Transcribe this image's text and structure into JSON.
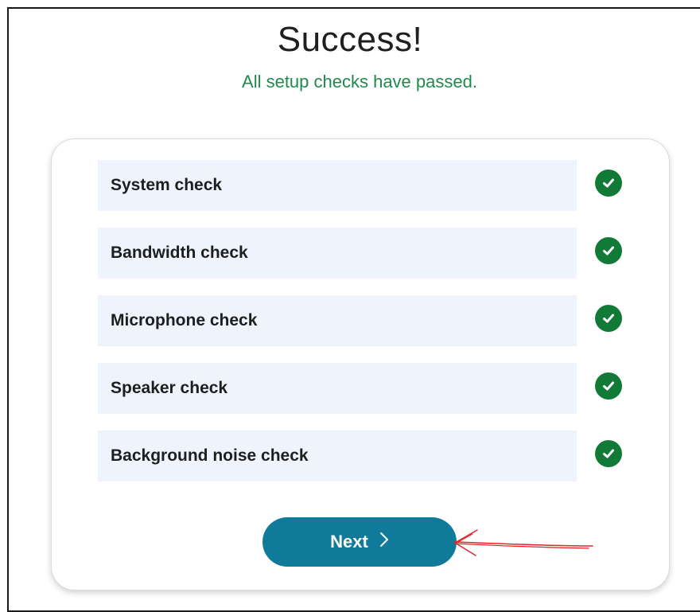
{
  "header": {
    "title": "Success!",
    "subtitle": "All setup checks have passed."
  },
  "checks": [
    {
      "label": "System check",
      "status": "passed",
      "icon": "checkmark-circle-icon"
    },
    {
      "label": "Bandwidth check",
      "status": "passed",
      "icon": "checkmark-circle-icon"
    },
    {
      "label": "Microphone check",
      "status": "passed",
      "icon": "checkmark-circle-icon"
    },
    {
      "label": "Speaker check",
      "status": "passed",
      "icon": "checkmark-circle-icon"
    },
    {
      "label": "Background noise check",
      "status": "passed",
      "icon": "checkmark-circle-icon"
    }
  ],
  "actions": {
    "next_label": "Next",
    "next_icon": "chevron-right-icon"
  },
  "annotation": {
    "icon": "red-arrow-icon",
    "color": "#e0262b"
  },
  "colors": {
    "success_text": "#1f8a4c",
    "check_icon": "#117a37",
    "row_background": "#eef3fd",
    "button": "#0f7a9a"
  }
}
